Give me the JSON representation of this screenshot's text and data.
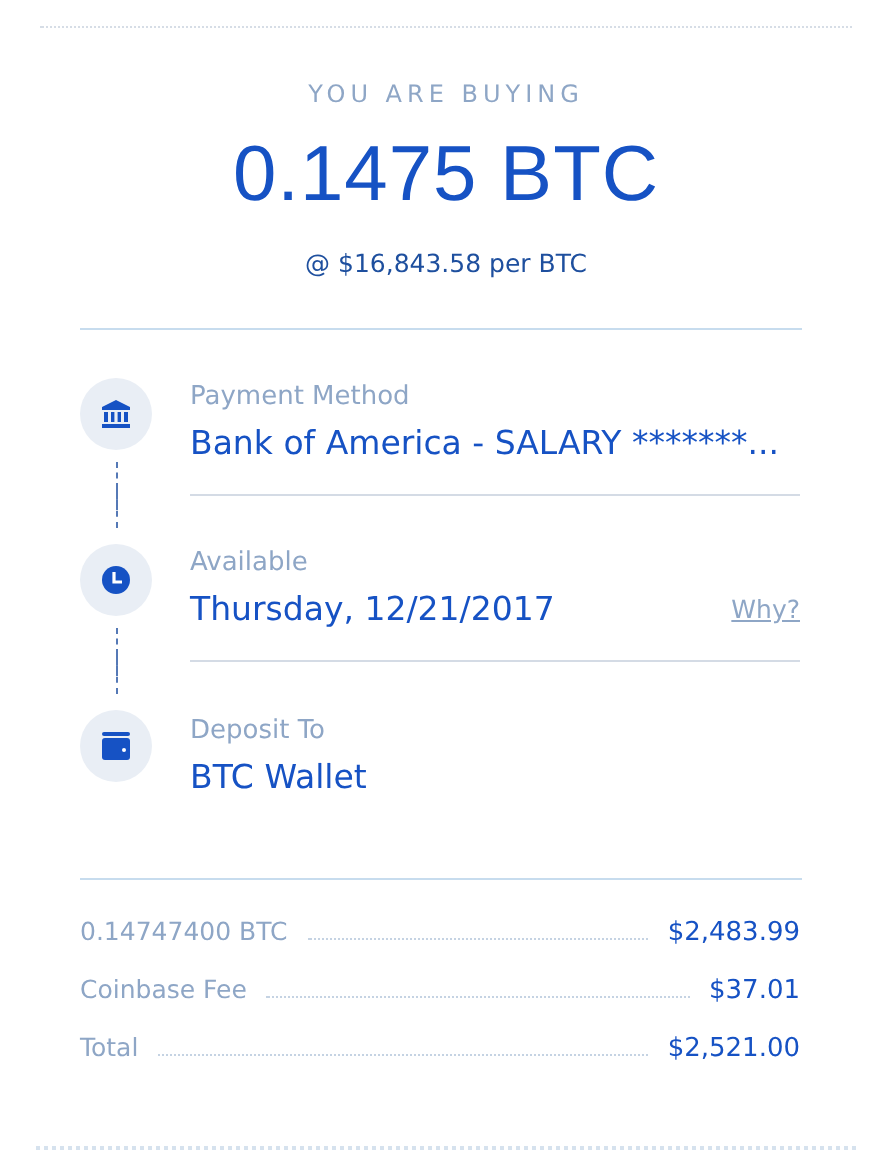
{
  "header": {
    "title": "YOU ARE BUYING",
    "amount": "0.1475 BTC",
    "rate": "@ $16,843.58 per BTC"
  },
  "steps": [
    {
      "kind": "bank",
      "label": "Payment Method",
      "value": "Bank of America - SALARY *******..."
    },
    {
      "kind": "clock",
      "label": "Available",
      "value": "Thursday, 12/21/2017",
      "link": "Why?"
    },
    {
      "kind": "wallet",
      "label": "Deposit To",
      "value": "BTC Wallet"
    }
  ],
  "summary": [
    {
      "label": "0.14747400 BTC",
      "amount": "$2,483.99"
    },
    {
      "label": "Coinbase Fee",
      "amount": "$37.01"
    },
    {
      "label": "Total",
      "amount": "$2,521.00"
    }
  ]
}
